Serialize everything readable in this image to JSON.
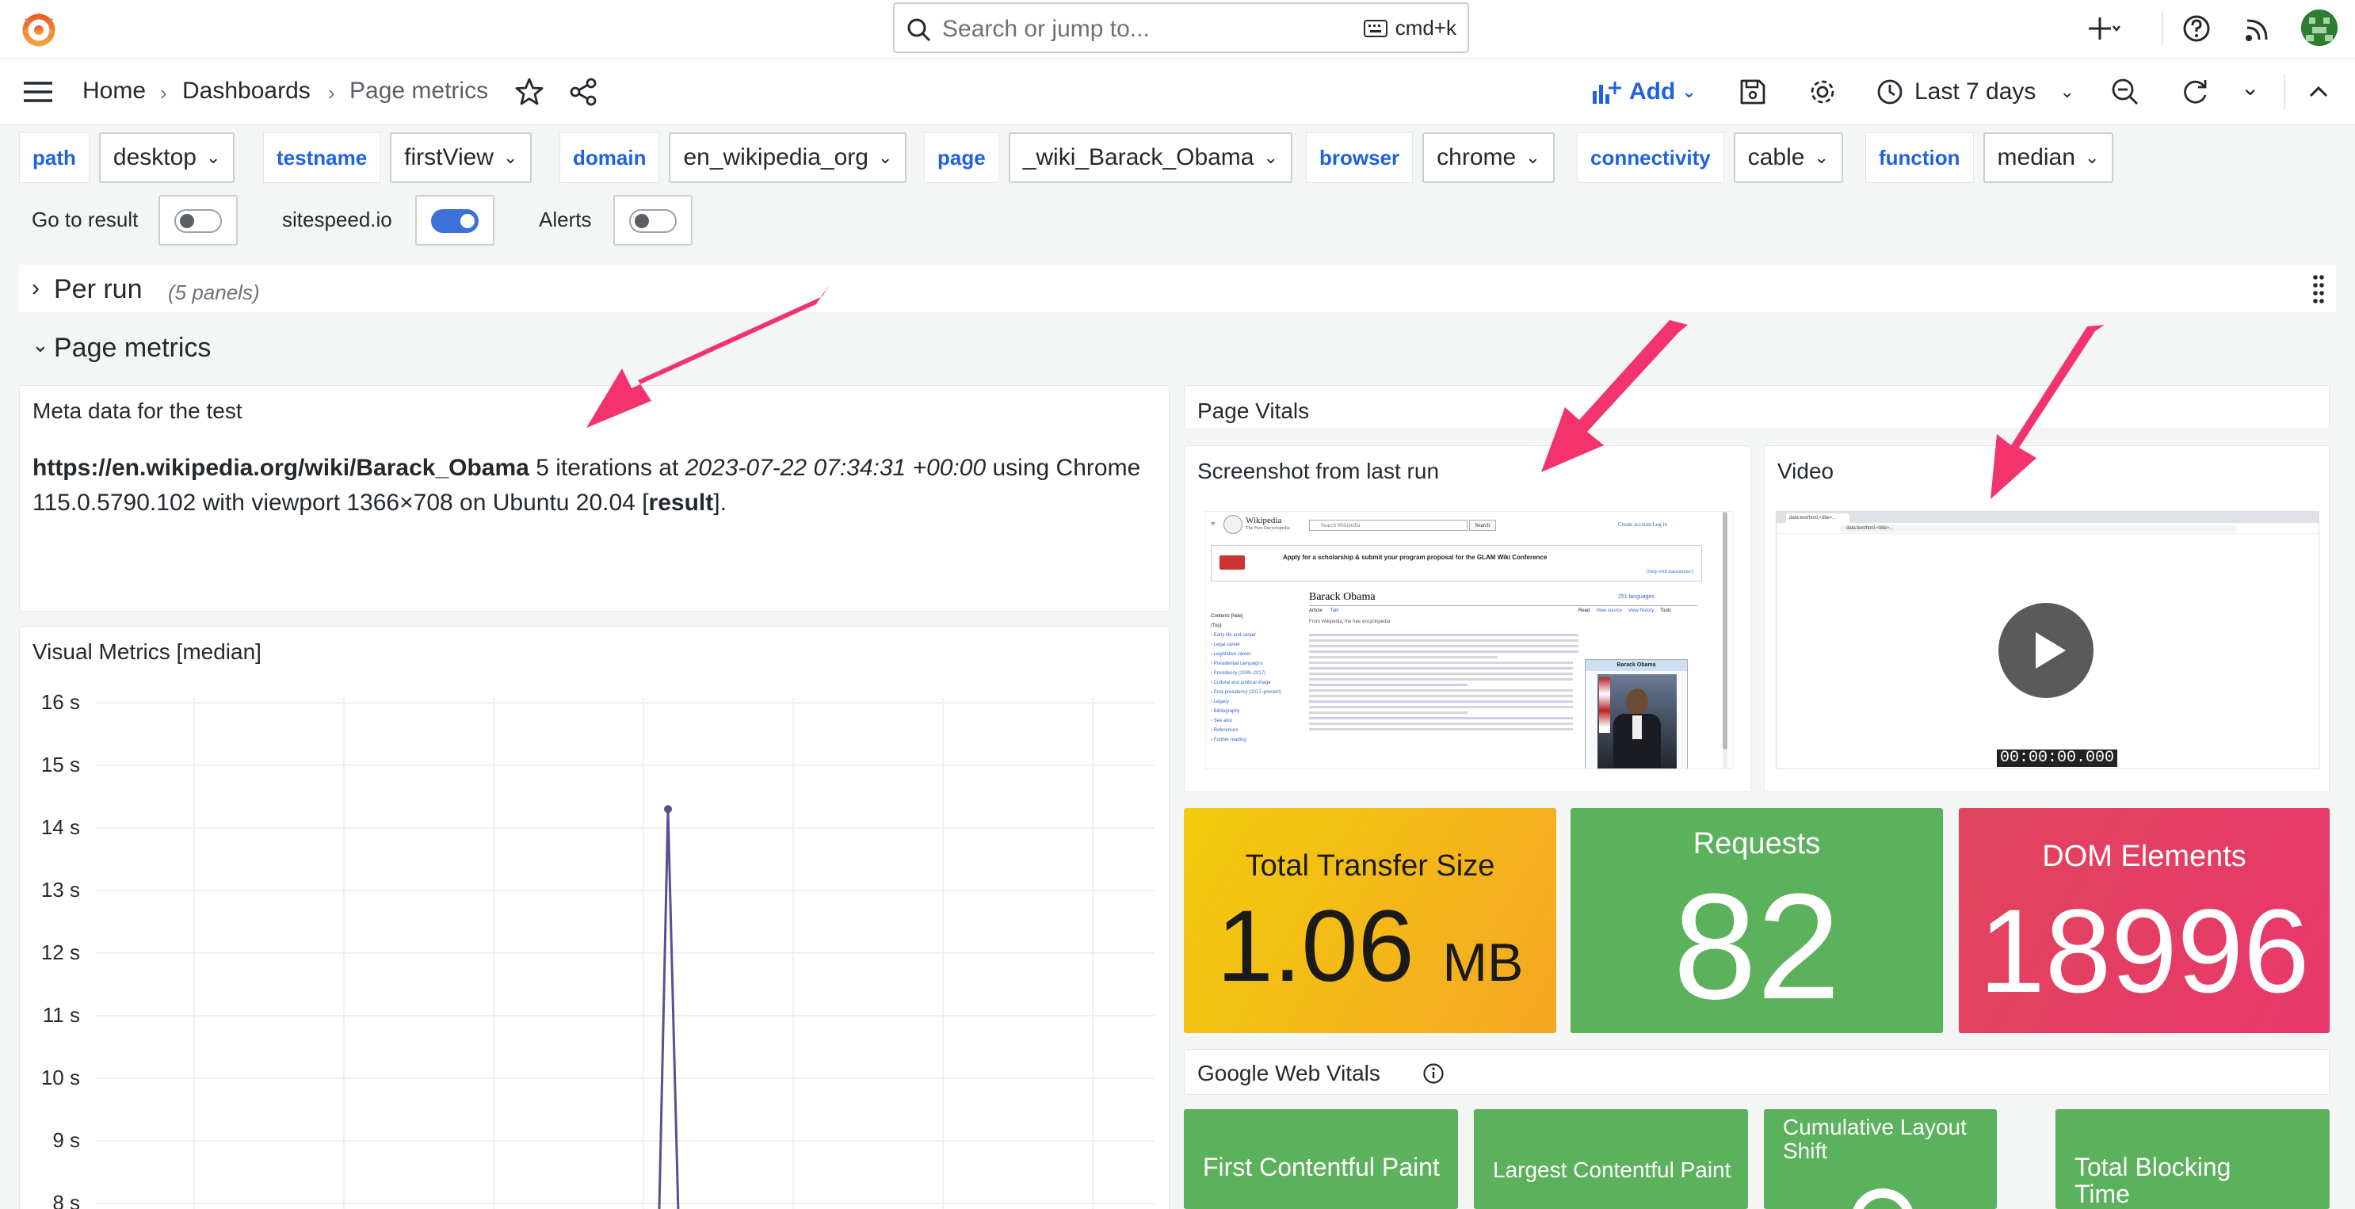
{
  "topbar": {
    "search_placeholder": "Search or jump to...",
    "search_shortcut": "cmd+k",
    "icons": [
      "grafana-logo-icon",
      "plus-icon",
      "help-icon",
      "news-icon",
      "user-avatar"
    ]
  },
  "breadcrumb": {
    "items": [
      "Home",
      "Dashboards",
      "Page metrics"
    ]
  },
  "toolbar": {
    "add_label": "Add",
    "time_range": "Last 7 days"
  },
  "variables": [
    {
      "label": "path",
      "value": "desktop"
    },
    {
      "label": "testname",
      "value": "firstView"
    },
    {
      "label": "domain",
      "value": "en_wikipedia_org"
    },
    {
      "label": "page",
      "value": "_wiki_Barack_Obama"
    },
    {
      "label": "browser",
      "value": "chrome"
    },
    {
      "label": "connectivity",
      "value": "cable"
    },
    {
      "label": "function",
      "value": "median"
    }
  ],
  "toggles": [
    {
      "label": "Go to result",
      "on": false
    },
    {
      "label": "sitespeed.io",
      "on": true
    },
    {
      "label": "Alerts",
      "on": false
    }
  ],
  "rows": {
    "per_run": {
      "title": "Per run",
      "count": "(5 panels)"
    },
    "page_metrics": {
      "title": "Page metrics"
    }
  },
  "meta_panel": {
    "title": "Meta data for the test",
    "url": "https://en.wikipedia.org/wiki/Barack_Obama",
    "iterations_text": "5 iterations at",
    "timestamp": "2023-07-22 07:34:31 +00:00",
    "using_text": "using Chrome 115.0.5790.102 with viewport 1366×708 on Ubuntu 20.04 [",
    "result_link": "result",
    "end_text": "]."
  },
  "visual_metrics_panel": {
    "title": "Visual Metrics [median]"
  },
  "page_vitals": {
    "title": "Page Vitals",
    "screenshot_title": "Screenshot from last run",
    "video_title": "Video",
    "video_time": "00:00:00.000",
    "wiki": {
      "logo_text": "Wikipedia",
      "logo_sub": "The Free Encyclopedia",
      "search": "Search Wikipedia",
      "search_btn": "Search",
      "links": "Create account  Log in",
      "banner": "Apply for a scholarship & submit your program proposal for the GLAM Wiki Conference",
      "banner_link": "[Help with translations!]",
      "article_title": "Barack Obama",
      "languages": "251 languages",
      "tab_article": "Article",
      "tab_talk": "Talk",
      "tab_read": "Read",
      "tab_view_source": "View source",
      "tab_history": "View history",
      "tab_tools": "Tools",
      "from": "From Wikipedia, the free encyclopedia",
      "toc": [
        "Contents [hide]",
        "(Top)",
        "Early life and career",
        "Legal career",
        "Legislative career",
        "Presidential campaigns",
        "Presidency (2009–2017)",
        "Cultural and political image",
        "Post-presidency (2017–present)",
        "Legacy",
        "Bibliography",
        "See also",
        "References",
        "Further reading"
      ],
      "infobox_title": "Barack Obama",
      "video_url": "data:text/html,<title>..."
    }
  },
  "stats": {
    "transfer": {
      "title": "Total Transfer Size",
      "value": "1.06",
      "unit": "MB",
      "color": "#f2cc0c"
    },
    "requests": {
      "title": "Requests",
      "value": "82",
      "color": "#5cb15c"
    },
    "dom": {
      "title": "DOM Elements",
      "value": "18996",
      "color": "#e0455c"
    }
  },
  "web_vitals": {
    "title": "Google Web Vitals",
    "tiles": [
      {
        "title": "First Contentful Paint"
      },
      {
        "title": "Largest Contentful Paint"
      },
      {
        "title": "Cumulative Layout Shift"
      },
      {
        "title": "Total Blocking Time"
      }
    ]
  },
  "chart_data": {
    "type": "line",
    "title": "Visual Metrics [median]",
    "y_ticks": [
      "16 s",
      "15 s",
      "14 s",
      "13 s",
      "12 s",
      "11 s",
      "10 s",
      "9 s",
      "8 s"
    ],
    "ylim": [
      8,
      16
    ],
    "series": [
      {
        "values": [
          14.3
        ],
        "color": "#5b4f8f"
      }
    ],
    "grid": true
  }
}
